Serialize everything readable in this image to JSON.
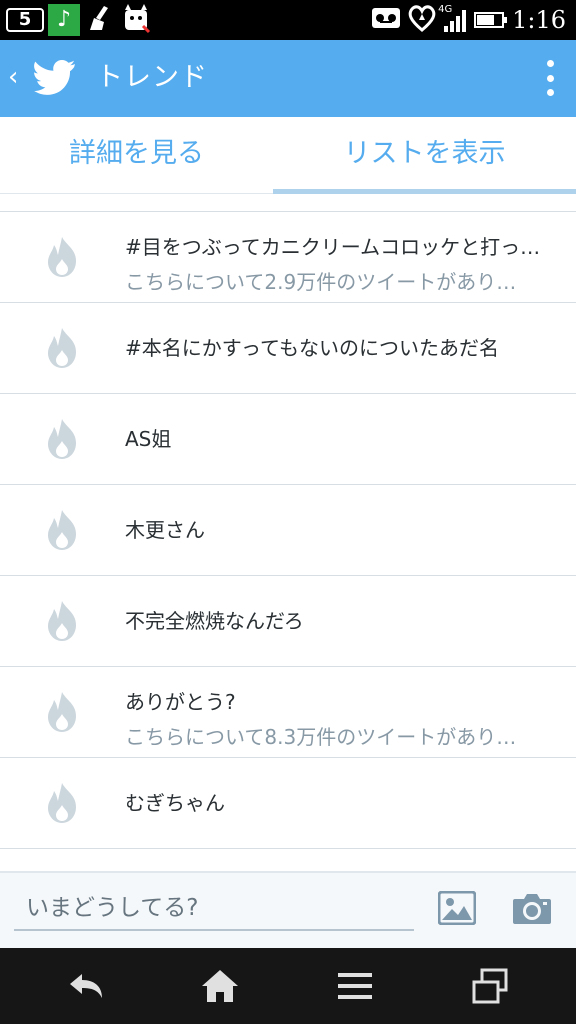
{
  "status_bar": {
    "notification_count": "5",
    "network": "4G",
    "time": "1:16",
    "icons": [
      "notification-count-icon",
      "music-icon",
      "cleaner-icon",
      "dog-app-icon",
      "voicemail-icon",
      "heart-icon",
      "signal-icon",
      "battery-charging-icon"
    ],
    "battery_level": 0.7
  },
  "action_bar": {
    "title": "トレンド",
    "icons": [
      "back-chevron-icon",
      "twitter-bird-icon",
      "overflow-menu-icon"
    ],
    "color": "#55acee"
  },
  "tabs": [
    {
      "label": "詳細を見る",
      "selected": false
    },
    {
      "label": "リストを表示",
      "selected": true
    }
  ],
  "trends": [
    {
      "title": "#目をつぶってカニクリームコロッケと打っ…",
      "subtitle": "こちらについて2.9万件のツイートがあり…"
    },
    {
      "title": "#本名にかすってもないのについたあだ名",
      "subtitle": ""
    },
    {
      "title": "AS姐",
      "subtitle": ""
    },
    {
      "title": "木更さん",
      "subtitle": ""
    },
    {
      "title": "不完全燃焼なんだろ",
      "subtitle": ""
    },
    {
      "title": "ありがとう?",
      "subtitle": "こちらについて8.3万件のツイートがあり…"
    },
    {
      "title": "むぎちゃん",
      "subtitle": ""
    }
  ],
  "compose": {
    "placeholder": "いまどうしてる?",
    "icons": [
      "photo-icon",
      "camera-icon"
    ]
  },
  "nav_bar": {
    "icons": [
      "back-icon",
      "home-icon",
      "menu-icon",
      "recent-apps-icon"
    ]
  }
}
